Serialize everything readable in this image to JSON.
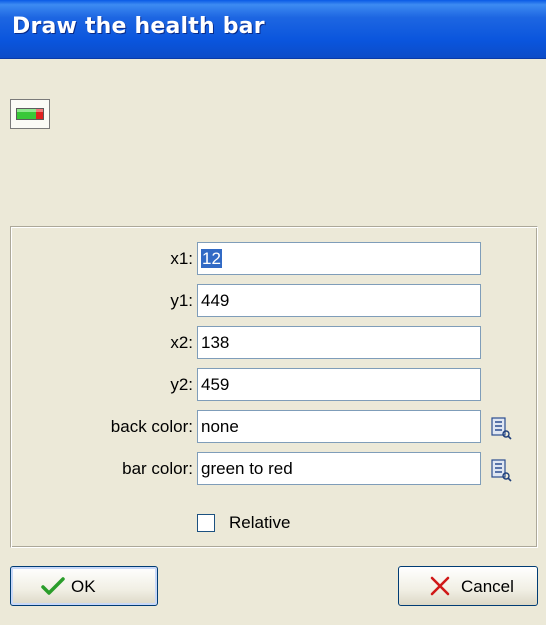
{
  "window": {
    "title": "Draw the health bar"
  },
  "action_icon": "health-bar-icon",
  "fields": [
    {
      "label": "x1:",
      "value": "12",
      "selected": true
    },
    {
      "label": "y1:",
      "value": "449"
    },
    {
      "label": "x2:",
      "value": "138"
    },
    {
      "label": "y2:",
      "value": "459"
    },
    {
      "label": "back color:",
      "value": "none",
      "picker": "color-picker-icon"
    },
    {
      "label": "bar color:",
      "value": "green to red",
      "picker": "color-picker-icon"
    }
  ],
  "relative": {
    "label": "Relative",
    "checked": false
  },
  "buttons": {
    "ok_label": "OK",
    "ok_icon": "checkmark-icon",
    "cancel_label": "Cancel",
    "cancel_icon": "close-icon"
  },
  "colors": {
    "title_bar": "#0a55dd",
    "dialog_bg": "#ece9d8",
    "selection": "#316ac5",
    "ok_check": "#2a9d2a",
    "cancel_x": "#d01818"
  }
}
